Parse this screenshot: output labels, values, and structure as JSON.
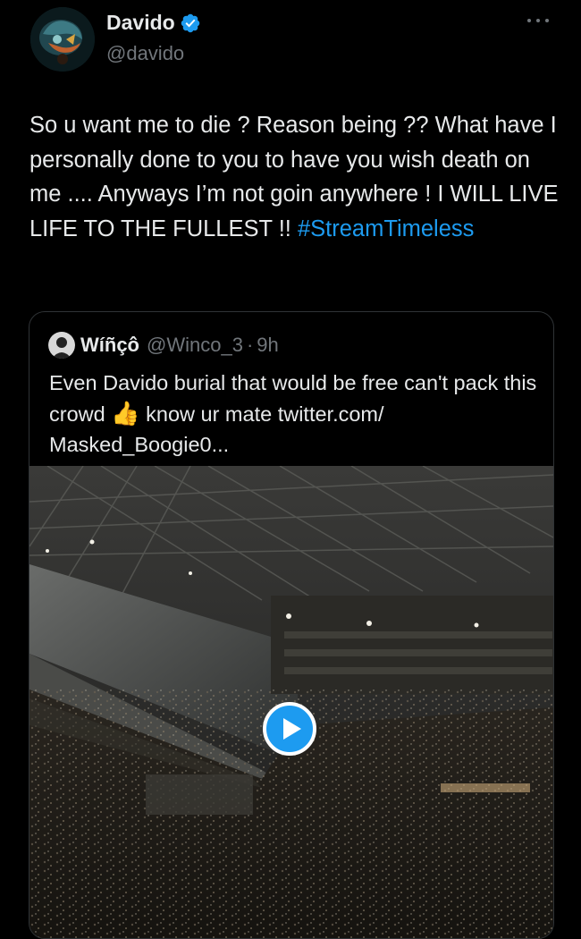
{
  "author": {
    "display_name": "Davido",
    "handle": "@davido",
    "verified": true
  },
  "tweet": {
    "text": "So u want me to die ? Reason being ?? What have I personally done to you to have you wish death on me .... Anyways I’m not goin anywhere ! I WILL LIVE LIFE TO THE FULLEST !! ",
    "hashtag": "#StreamTimeless"
  },
  "quoted_tweet": {
    "display_name": "Wíñçô",
    "handle": "@Winco_3",
    "separator": "·",
    "time": "9h",
    "text_before_emoji": "Even Davido burial that would be free can't pack this crowd ",
    "emoji": "👍",
    "text_after_emoji": " know ur mate twitter.com/ Masked_Boogie0...",
    "media": {
      "type": "video",
      "play_icon": "play-icon"
    }
  },
  "icons": {
    "more": "more-icon",
    "verified": "verified-badge-icon"
  },
  "colors": {
    "background": "#000000",
    "text": "#e7e9ea",
    "secondary": "#71767b",
    "accent": "#1d9bf0",
    "border": "#2f3336"
  }
}
